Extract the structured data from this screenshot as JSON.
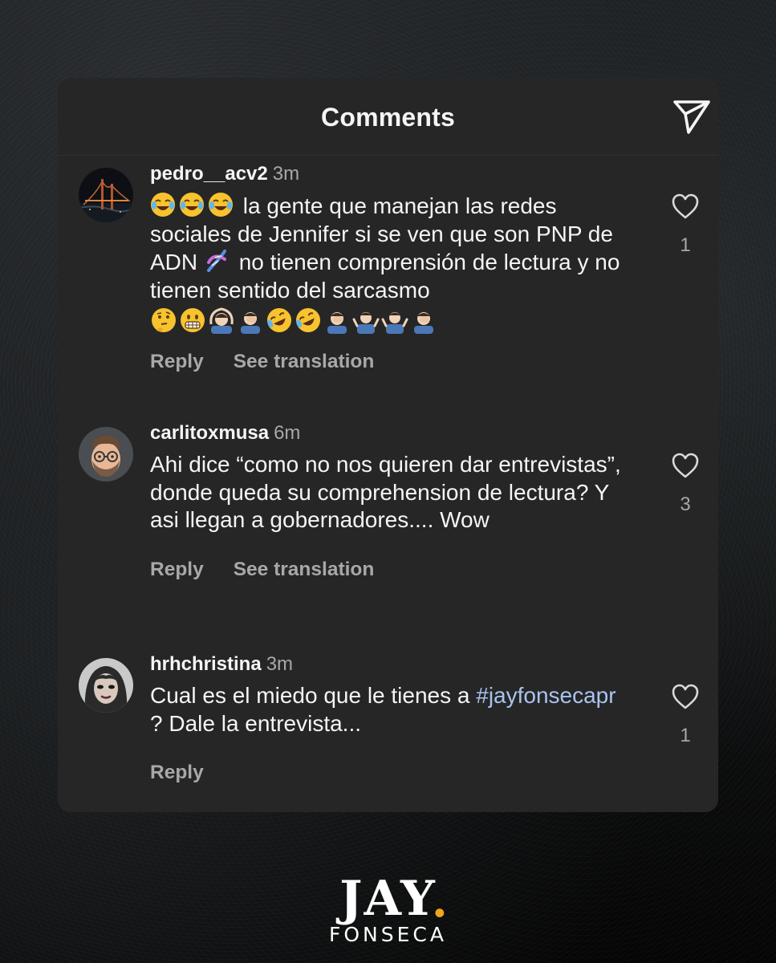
{
  "header": {
    "title": "Comments",
    "share_icon": "send-paper-plane-icon"
  },
  "comments": [
    {
      "username": "pedro__acv2",
      "time": "3m",
      "avatar": "golden-gate-bridge-night-photo",
      "emoji_prefix": [
        "face-with-tears-of-joy",
        "face-with-tears-of-joy",
        "face-with-tears-of-joy"
      ],
      "text_part1": "la gente que manejan las redes sociales de Jennifer si se ven que son PNP de ADN",
      "inline_emoji": "dna",
      "text_part2": "no tienen comprensión de lectura y no tienen sentido del sarcasmo",
      "emoji_suffix": [
        "thinking-face",
        "grimacing-face",
        "person-gesturing-ok",
        "man-facepalming",
        "rolling-on-floor-laughing",
        "rolling-on-floor-laughing",
        "man-facepalming",
        "man-shrugging",
        "man-shrugging",
        "man-facepalming"
      ],
      "likes": "1",
      "reply_label": "Reply",
      "translate_label": "See translation"
    },
    {
      "username": "carlitoxmusa",
      "time": "6m",
      "avatar": "memoji-man-glasses-beard",
      "text": "Ahi dice “como no nos quieren dar entrevistas”, donde queda su comprehension de lectura? Y asi llegan a gobernadores.... Wow",
      "likes": "3",
      "reply_label": "Reply",
      "translate_label": "See translation"
    },
    {
      "username": "hrhchristina",
      "time": "3m",
      "avatar": "woman-portrait-dark-makeup",
      "text_pre": "Cual es el miedo que le tienes a",
      "hashtag": "#jayfonsecapr",
      "text_post": "? Dale la entrevista...",
      "likes": "1",
      "reply_label": "Reply"
    }
  ],
  "brand": {
    "top": "JAY",
    "dot": ".",
    "bottom": "FONSECA",
    "dot_color": "#f2a51a"
  },
  "colors": {
    "panel_bg": "#262626",
    "text_primary": "#f5f5f5",
    "text_secondary": "#a8a8a8",
    "hashtag": "#a9c4ee"
  }
}
